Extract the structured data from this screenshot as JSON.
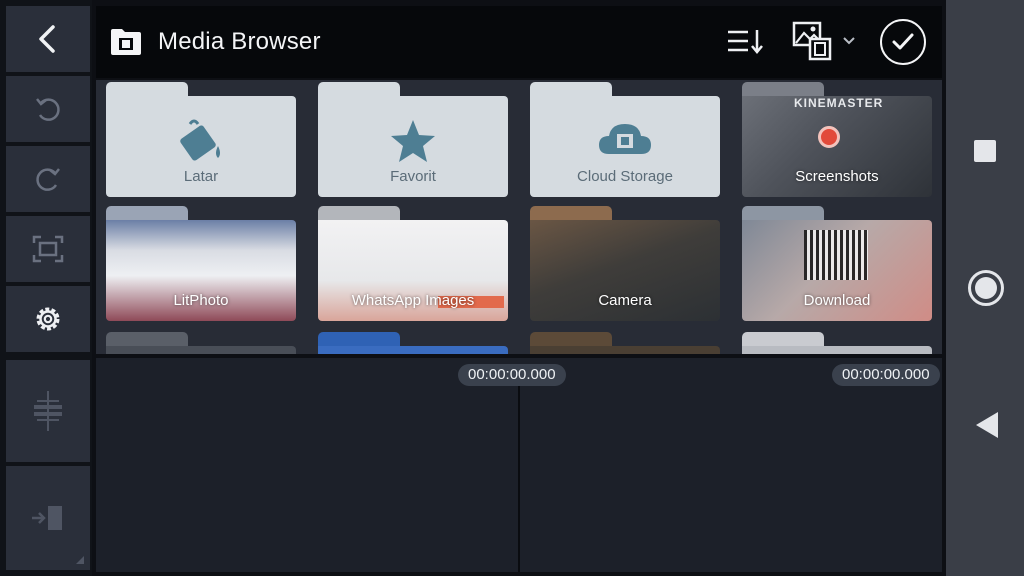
{
  "header": {
    "title": "Media Browser"
  },
  "folders": [
    {
      "name": "Latar",
      "kind": "plain",
      "icon": "paint-bucket-icon"
    },
    {
      "name": "Favorit",
      "kind": "plain",
      "icon": "star-icon"
    },
    {
      "name": "Cloud Storage",
      "kind": "plain",
      "icon": "cloud-film-icon"
    },
    {
      "name": "Screenshots",
      "kind": "photo",
      "thumb_overlay": "KINEMASTER"
    },
    {
      "name": "LitPhoto",
      "kind": "photo"
    },
    {
      "name": "WhatsApp Images",
      "kind": "photo"
    },
    {
      "name": "Camera",
      "kind": "photo"
    },
    {
      "name": "Download",
      "kind": "photo"
    }
  ],
  "timeline": {
    "left_timecode": "00:00:00.000",
    "right_timecode": "00:00:00.000"
  },
  "colors": {
    "accent_icon": "#4e7e93",
    "tile_bg": "#d5dbe0",
    "panel_bg": "#282c36"
  }
}
